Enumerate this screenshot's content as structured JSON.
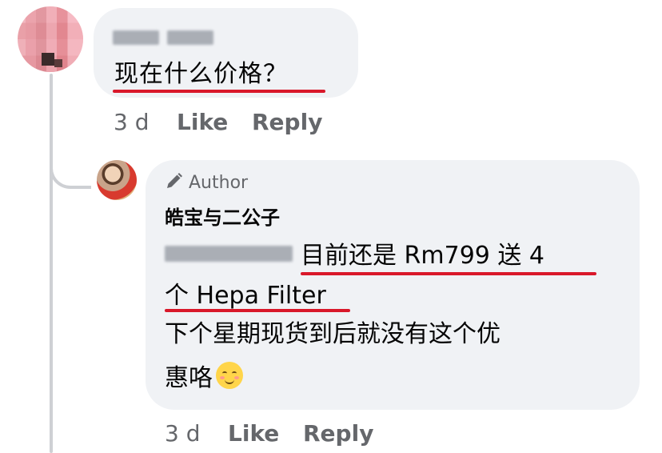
{
  "comment": {
    "text": "现在什么价格？",
    "time": "3 d",
    "like_label": "Like",
    "reply_label": "Reply"
  },
  "reply": {
    "badge": "Author",
    "badge_icon": "pencil-icon",
    "author_name": "皓宝与二公子",
    "line1": "目前还是 Rm799 送 4",
    "line2": "个 Hepa Filter",
    "line3": "下个星期现货到后就没有这个优",
    "line4": "惠咯",
    "emoji_icon": "smiling-face-emoji",
    "time": "3 d",
    "like_label": "Like",
    "reply_label": "Reply"
  },
  "colors": {
    "bubble_bg": "#f0f2f5",
    "meta_text": "#65676b",
    "highlight_underline": "#d9182a"
  }
}
